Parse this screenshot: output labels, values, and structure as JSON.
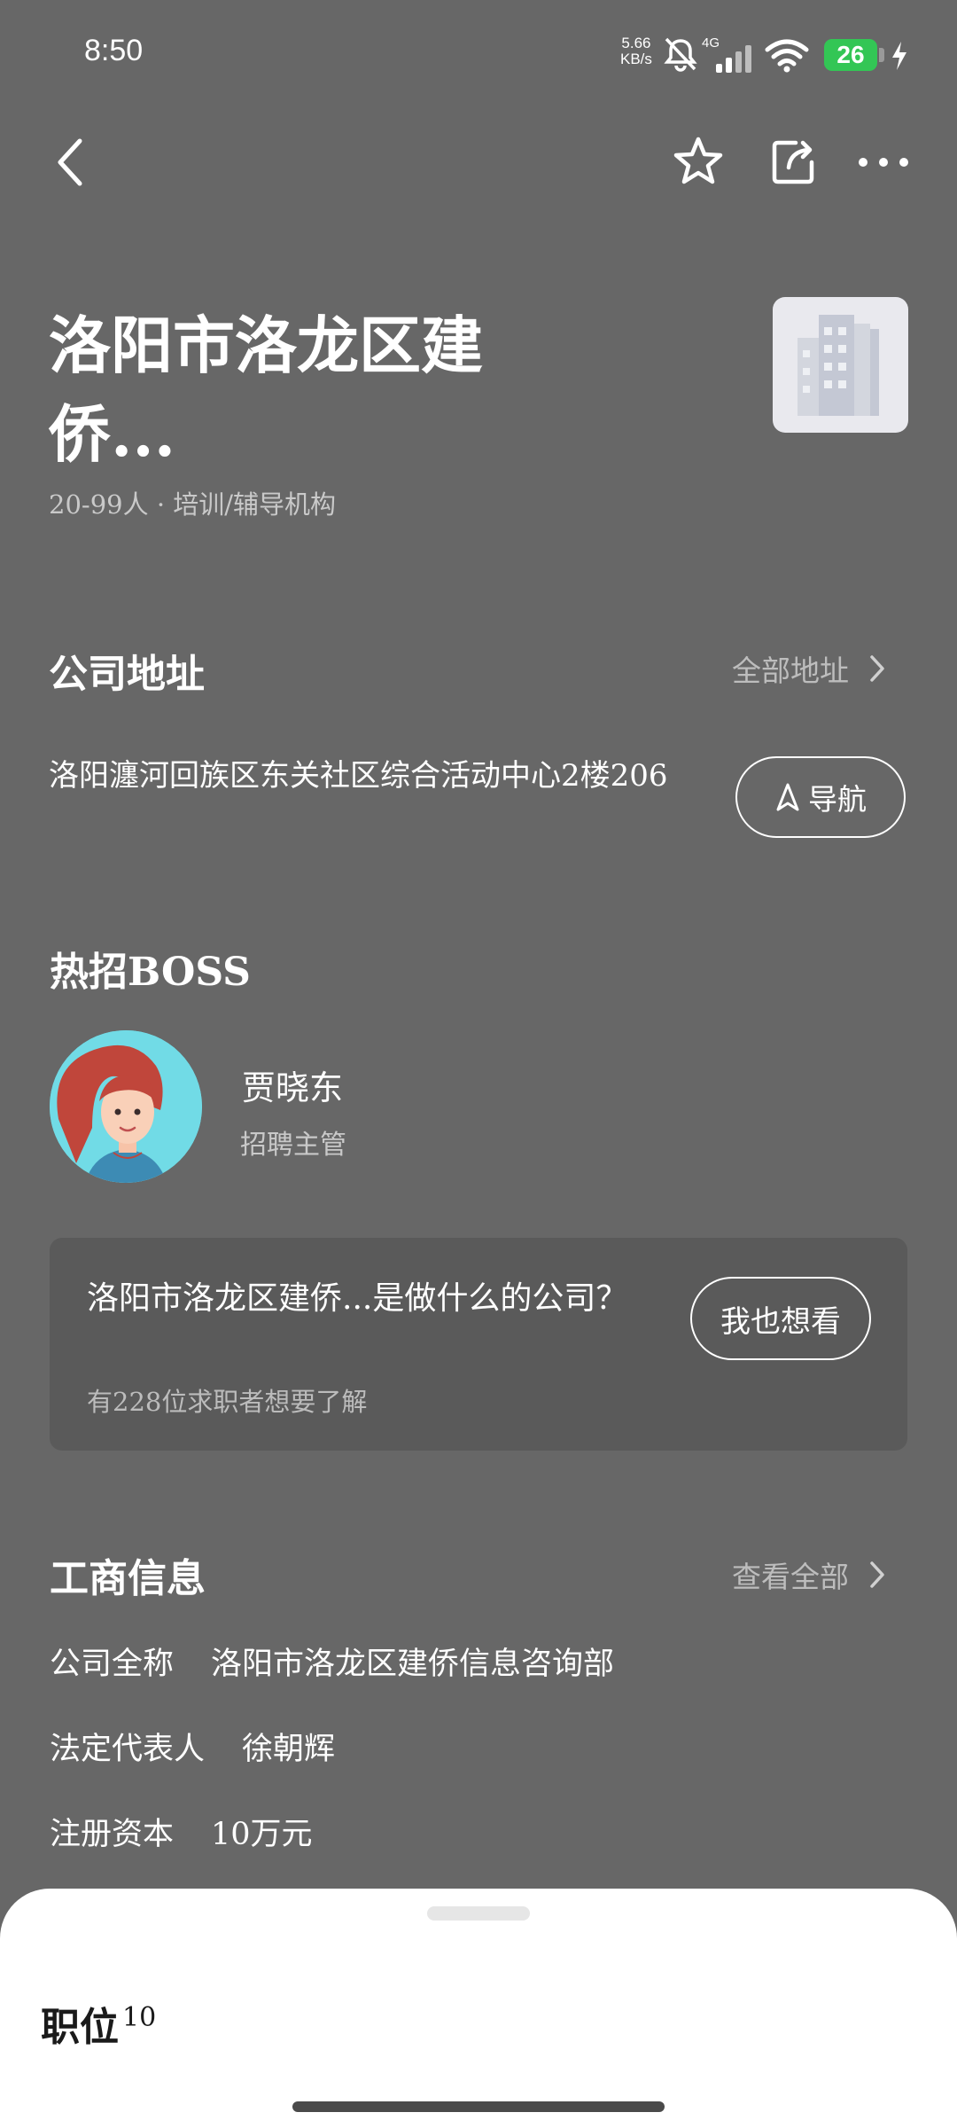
{
  "status_bar": {
    "time": "8:50",
    "net_speed_value": "5.66",
    "net_speed_unit": "KB/s",
    "network": "4G",
    "battery": "26"
  },
  "top_bar": {
    "icons": [
      "back-icon",
      "star-icon",
      "share-icon",
      "more-icon"
    ]
  },
  "company": {
    "name": "洛阳市洛龙区建侨...",
    "meta": "20-99人 · 培训/辅导机构"
  },
  "address_section": {
    "title": "公司地址",
    "link": "全部地址",
    "address": "洛阳瀍河回族区东关社区综合活动中心2楼206",
    "nav_label": "导航"
  },
  "boss_section": {
    "title": "热招BOSS",
    "name": "贾晓东",
    "role": "招聘主管"
  },
  "ask_card": {
    "question": "洛阳市洛龙区建侨...是做什么的公司？",
    "sub": "有228位求职者想要了解",
    "button": "我也想看"
  },
  "business_section": {
    "title": "工商信息",
    "link": "查看全部",
    "rows": [
      {
        "key": "公司全称",
        "value": "洛阳市洛龙区建侨信息咨询部"
      },
      {
        "key": "法定代表人",
        "value": "徐朝辉"
      },
      {
        "key": "注册资本",
        "value": "10万元"
      }
    ]
  },
  "bottom_sheet": {
    "title": "职位",
    "count": "10"
  },
  "colors": {
    "background": "#676767",
    "card": "#5a5a5a",
    "battery": "#33c655",
    "sheet": "#ffffff"
  }
}
